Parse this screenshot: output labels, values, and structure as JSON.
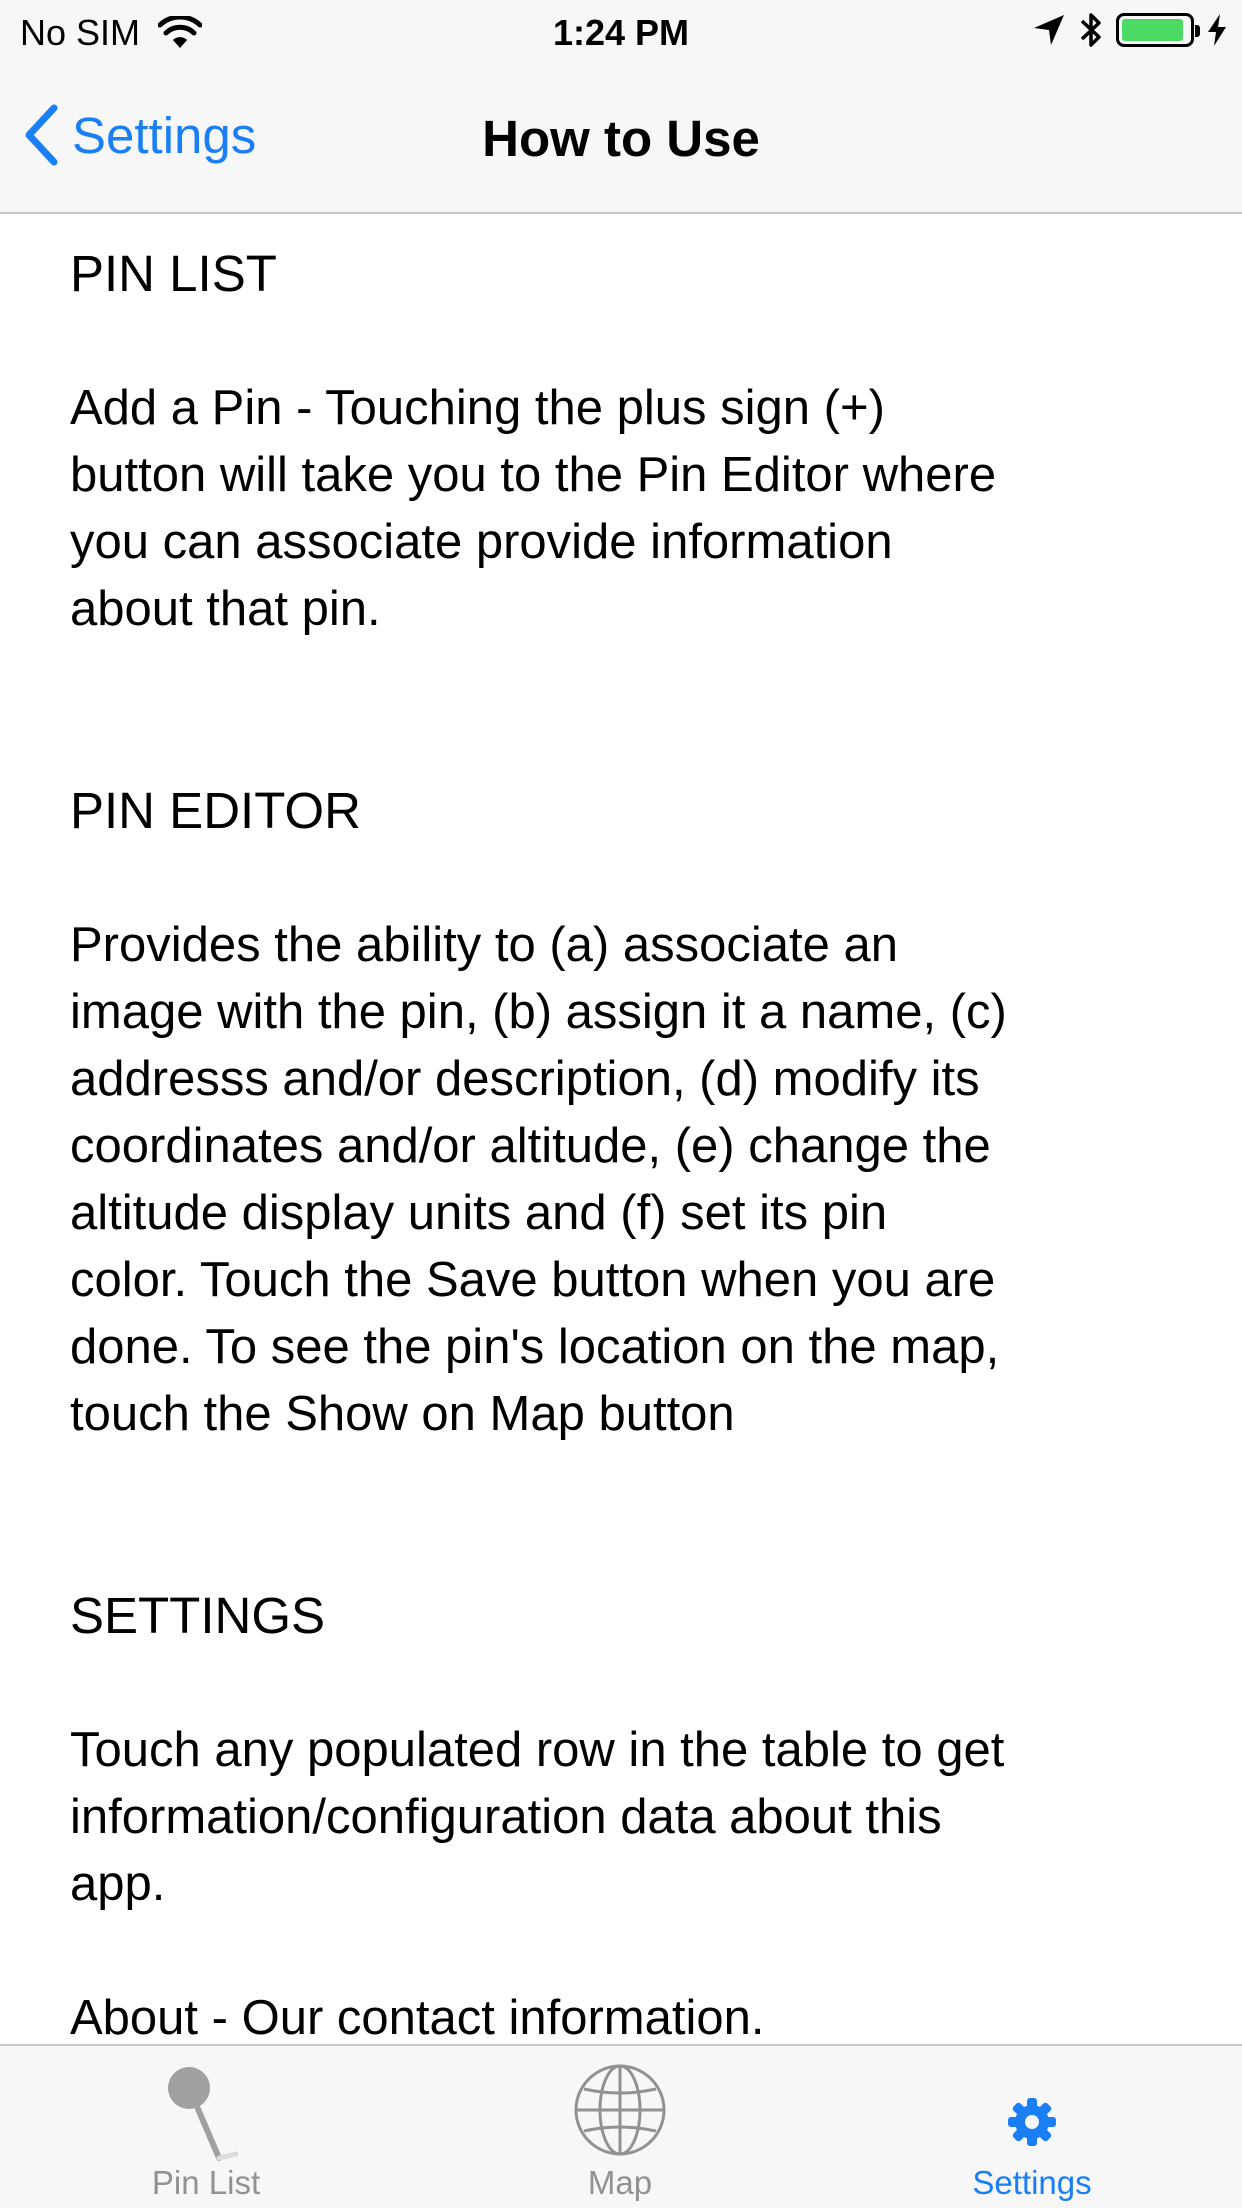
{
  "status_bar": {
    "carrier": "No SIM",
    "time": "1:24 PM",
    "battery_color": "#4cd964"
  },
  "nav": {
    "back_label": "Settings",
    "title": "How to Use",
    "accent_color": "#1a7ef5"
  },
  "content": {
    "sections": [
      {
        "heading": "PIN LIST",
        "paragraphs": [
          "Add a Pin - Touching the plus sign (+)\nbutton will take you to the Pin Editor where\nyou can associate provide information\nabout that pin."
        ]
      },
      {
        "heading": "PIN EDITOR",
        "paragraphs": [
          "Provides the ability to (a) associate an\nimage with the pin, (b) assign it a name, (c)\naddresss and/or description, (d) modify its\ncoordinates and/or altitude, (e) change the\naltitude display units and (f) set its pin\ncolor.  Touch the Save button when you are\ndone.  To see the pin's location on the map,\ntouch the Show on Map button"
        ]
      },
      {
        "heading": "SETTINGS",
        "paragraphs": [
          "Touch any populated row in the table to get\ninformation/configuration data about this\napp.",
          "About - Our contact information."
        ]
      }
    ]
  },
  "tab_bar": {
    "tabs": [
      {
        "label": "Pin List",
        "icon": "pin-icon",
        "active": false
      },
      {
        "label": "Map",
        "icon": "globe-icon",
        "active": false
      },
      {
        "label": "Settings",
        "icon": "gear-icon",
        "active": true
      }
    ],
    "active_color": "#1a7ef5",
    "inactive_color": "#929292"
  }
}
